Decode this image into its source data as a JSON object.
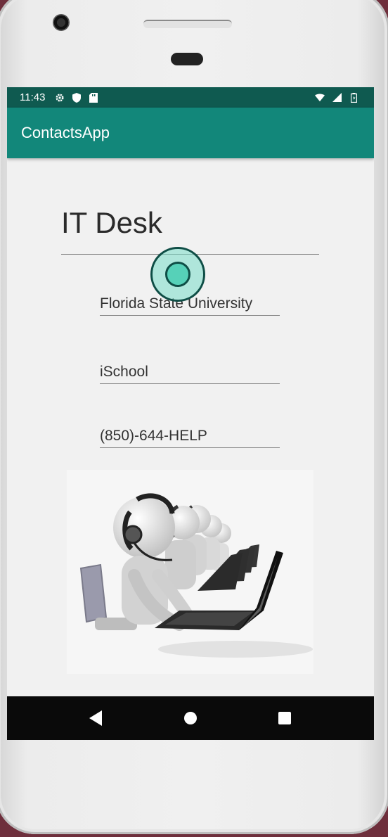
{
  "status_bar": {
    "time": "11:43",
    "icons": [
      "settings-icon",
      "shield-icon",
      "sd-card-icon",
      "wifi-icon",
      "signal-icon",
      "battery-icon"
    ]
  },
  "app_bar": {
    "title": "ContactsApp"
  },
  "contact": {
    "name": "IT Desk",
    "organization": "Florida State University",
    "department": "iSchool",
    "phone": "(850)-644-HELP"
  },
  "image": {
    "icon": "help-desk-illustration"
  },
  "nav_bar": {
    "icons": [
      "back-icon",
      "home-icon",
      "recents-icon"
    ]
  },
  "colors": {
    "status_bar": "#0f5a50",
    "app_bar": "#12877a",
    "screen_bg": "#f1f1f1",
    "nav_bar": "#0a0a0a",
    "touch_indicator": "#56d1b8"
  }
}
